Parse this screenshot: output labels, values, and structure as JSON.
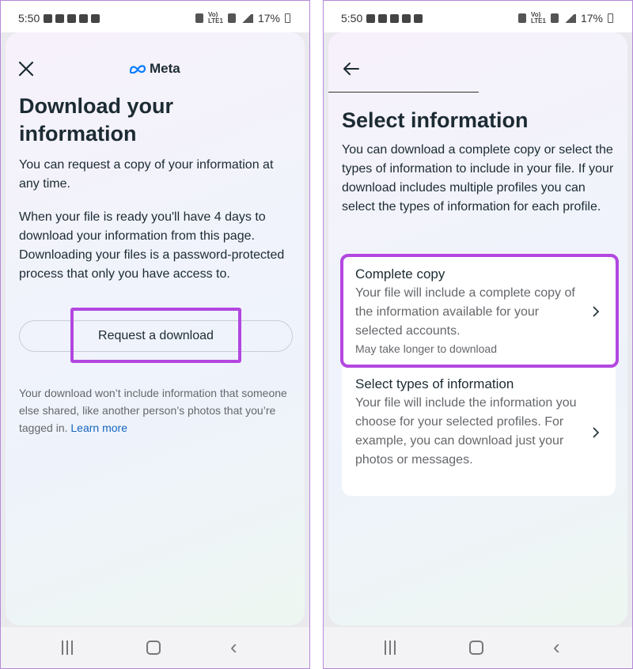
{
  "statusbar": {
    "time": "5:50",
    "battery": "17%",
    "network": "VoLTE LTE1"
  },
  "left": {
    "brand": "Meta",
    "title": "Download your information",
    "para1": "You can request a copy of your information at any time.",
    "para2": "When your file is ready you'll have 4 days to download your information from this page. Downloading your files is a password-protected process that only you have access to.",
    "request_button": "Request a download",
    "disclaimer": "Your download won’t include information that someone else shared, like another person’s photos that you’re tagged in.",
    "learn_more": "Learn more"
  },
  "right": {
    "title": "Select information",
    "para": "You can download a complete copy or select the types of information to include in your file. If your download includes multiple profiles you can select the types of information for each profile.",
    "options": [
      {
        "title": "Complete copy",
        "desc": "Your file will include a complete copy of the information available for your selected accounts.",
        "note": "May take longer to download"
      },
      {
        "title": "Select types of information",
        "desc": "Your file will include the information you choose for your selected profiles. For example, you can download just your photos or messages."
      }
    ]
  },
  "colors": {
    "highlight": "#b347e0",
    "link": "#1565c0",
    "text": "#1c2b33",
    "secondary": "#65676b"
  },
  "icons": [
    "close-icon",
    "meta-logo-icon",
    "back-arrow-icon",
    "chevron-right-icon",
    "nav-recents-icon",
    "nav-home-icon",
    "nav-back-icon"
  ]
}
